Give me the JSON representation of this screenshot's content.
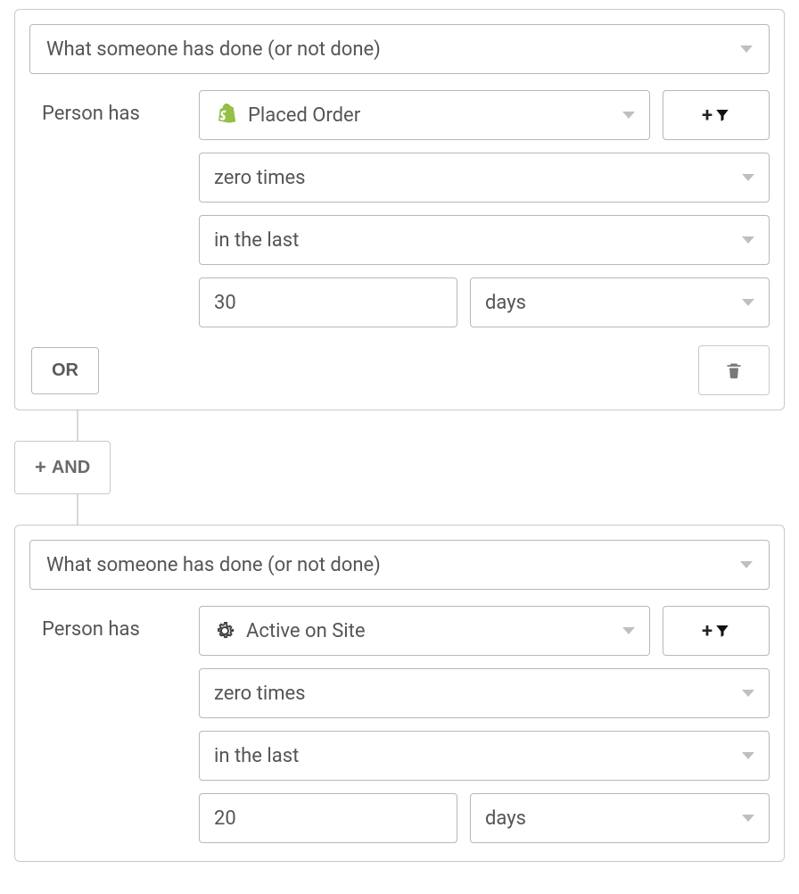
{
  "rules": [
    {
      "condition_type": "What someone has done (or not done)",
      "person_has_label": "Person has",
      "activity": "Placed Order",
      "activity_icon": "shopify",
      "frequency": "zero times",
      "timeframe": "in the last",
      "amount": "30",
      "unit": "days",
      "or_label": "OR"
    },
    {
      "condition_type": "What someone has done (or not done)",
      "person_has_label": "Person has",
      "activity": "Active on Site",
      "activity_icon": "gear",
      "frequency": "zero times",
      "timeframe": "in the last",
      "amount": "20",
      "unit": "days"
    }
  ],
  "and_label": "AND"
}
